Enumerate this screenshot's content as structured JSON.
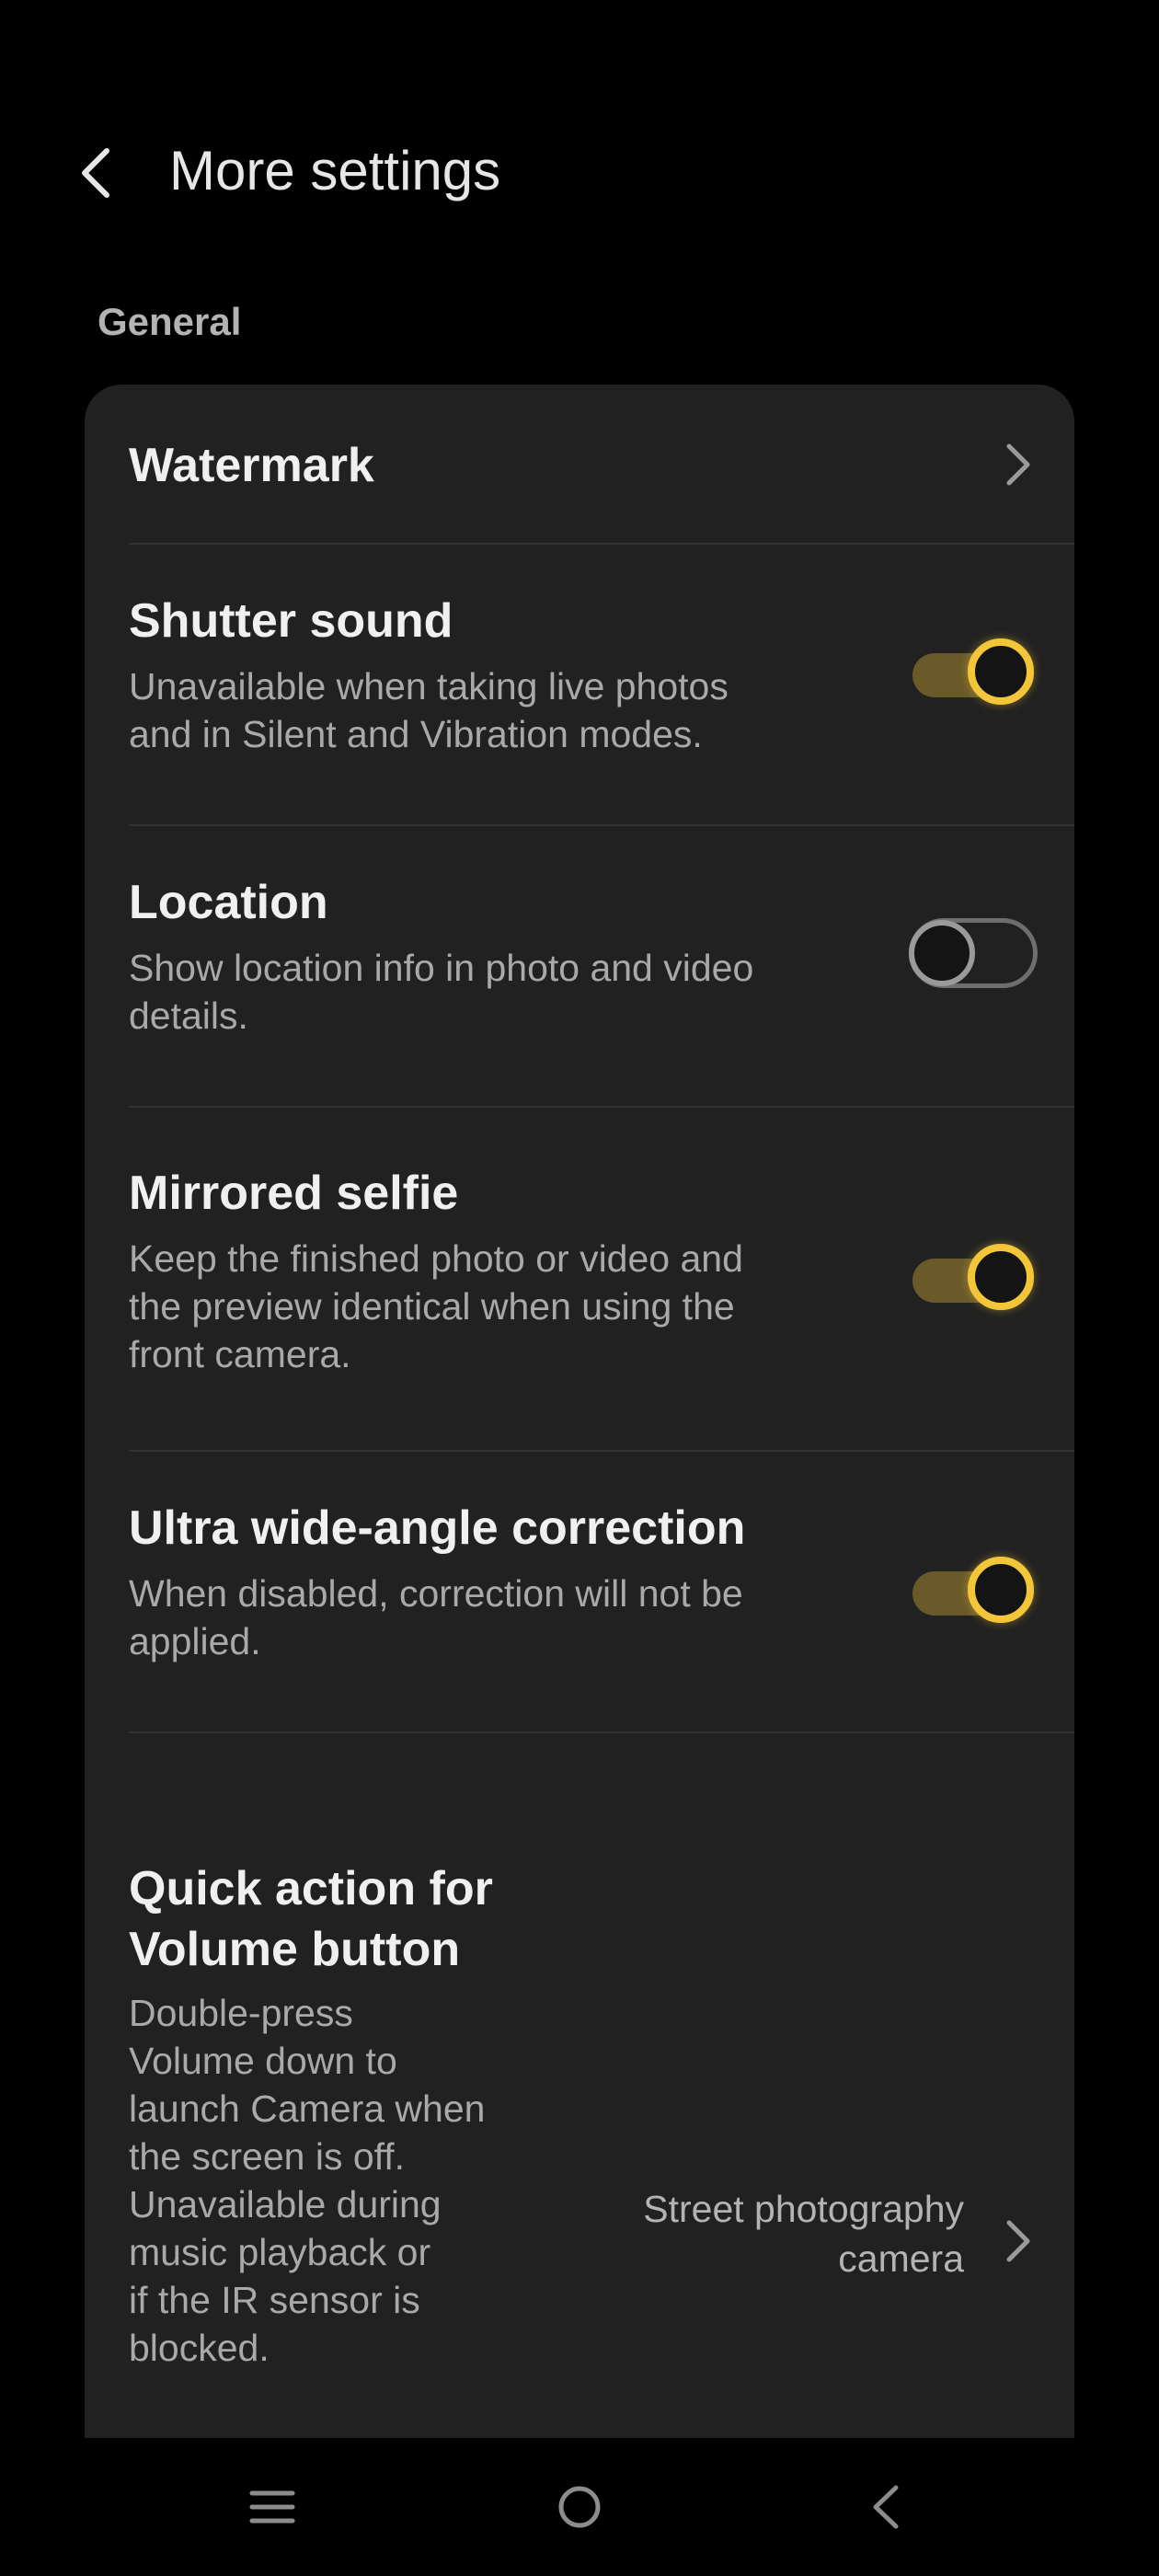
{
  "header": {
    "title": "More settings"
  },
  "section": {
    "label": "General"
  },
  "settings": {
    "watermark": {
      "title": "Watermark"
    },
    "shutter_sound": {
      "title": "Shutter sound",
      "subtitle_lines": [
        "Unavailable when taking live photos",
        "and in Silent and Vibration modes."
      ],
      "enabled": true
    },
    "location": {
      "title": "Location",
      "subtitle_lines": [
        "Show location info in photo and video",
        "details."
      ],
      "enabled": false
    },
    "mirrored_selfie": {
      "title": "Mirrored selfie",
      "subtitle_lines": [
        "Keep the finished photo or video and",
        "the preview identical when using the",
        "front camera."
      ],
      "enabled": true
    },
    "ultra_wide": {
      "title": "Ultra wide-angle correction",
      "subtitle_lines": [
        "When disabled, correction will not be",
        "applied."
      ],
      "enabled": true
    },
    "quick_action": {
      "title_lines": [
        "Quick action for",
        "Volume button"
      ],
      "subtitle_lines": [
        "Double-press",
        "Volume down to",
        "launch Camera when",
        "the screen is off.",
        "Unavailable during",
        "music playback or",
        "if the IR sensor is",
        "blocked."
      ],
      "value_lines": [
        "Street photography",
        "camera"
      ]
    }
  },
  "icons": {
    "back": "chevron-left-icon",
    "chevron": "chevron-right-icon",
    "nav_menu": "menu-icon",
    "nav_home": "home-circle-icon",
    "nav_back": "back-triangle-icon"
  },
  "colors": {
    "accent": "#f3c63a",
    "card": "#212121",
    "background": "#000000"
  }
}
